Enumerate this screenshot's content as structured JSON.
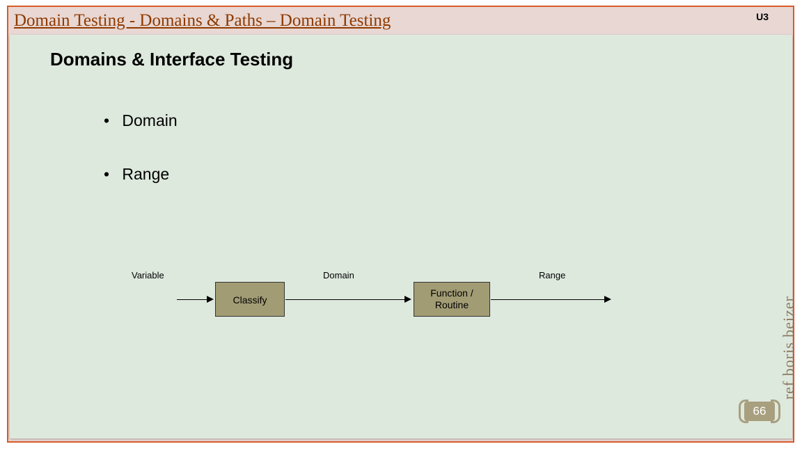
{
  "header": {
    "main_title": "Domain Testing  -  Domains & Paths – Domain Testing",
    "unit": "U3"
  },
  "content": {
    "section_heading": "Domains & Interface Testing",
    "bullets": [
      "Domain",
      "Range"
    ]
  },
  "diagram": {
    "labels": {
      "variable": "Variable",
      "domain": "Domain",
      "range": "Range"
    },
    "boxes": {
      "classify": "Classify",
      "function": "Function / Routine"
    }
  },
  "side_citation": "ref boris beizer",
  "page_number": "66"
}
